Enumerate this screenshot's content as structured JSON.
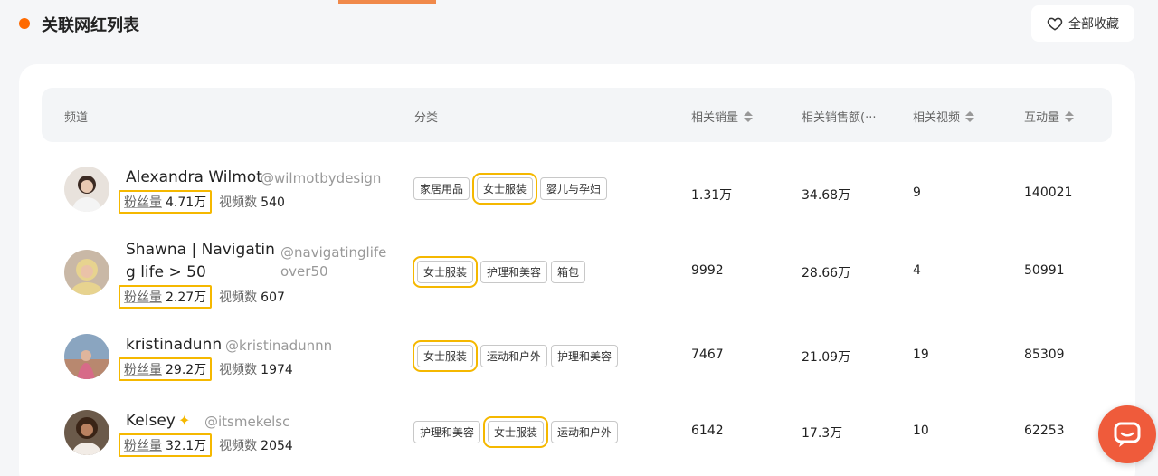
{
  "header": {
    "title": "关联网红列表",
    "favorite_label": "全部收藏"
  },
  "table": {
    "columns": {
      "channel": "频道",
      "category": "分类",
      "sales": "相关销量",
      "revenue": "相关销售额(···",
      "videos": "相关视频",
      "engagement": "互动量"
    },
    "stat_labels": {
      "fans": "粉丝量",
      "videos": "视频数"
    },
    "rows": [
      {
        "name": "Alexandra Wilmot",
        "handle": "@wilmotbydesign",
        "fans": "4.71万",
        "videos": "540",
        "tags": [
          "家居用品",
          "女士服装",
          "婴儿与孕妇"
        ],
        "sales": "1.31万",
        "revenue": "34.68万",
        "related_videos": "9",
        "engagement": "140021"
      },
      {
        "name_line1": "Shawna | Navigatin",
        "name_line2": "g life > 50",
        "handle_line1": "@navigatinglife",
        "handle_line2": "over50",
        "fans": "2.27万",
        "videos": "607",
        "tags": [
          "女士服装",
          "护理和美容",
          "箱包"
        ],
        "sales": "9992",
        "revenue": "28.66万",
        "related_videos": "4",
        "engagement": "50991"
      },
      {
        "name": "kristinadunn",
        "handle": "@kristinadunnn",
        "fans": "29.2万",
        "videos": "1974",
        "tags": [
          "女士服装",
          "运动和户外",
          "护理和美容"
        ],
        "sales": "7467",
        "revenue": "21.09万",
        "related_videos": "19",
        "engagement": "85309"
      },
      {
        "name": "Kelsey",
        "handle": "@itsmekelsc",
        "fans": "32.1万",
        "videos": "2054",
        "tags": [
          "护理和美容",
          "女士服装",
          "运动和户外"
        ],
        "sales": "6142",
        "revenue": "17.3万",
        "related_videos": "10",
        "engagement": "62253"
      }
    ]
  }
}
